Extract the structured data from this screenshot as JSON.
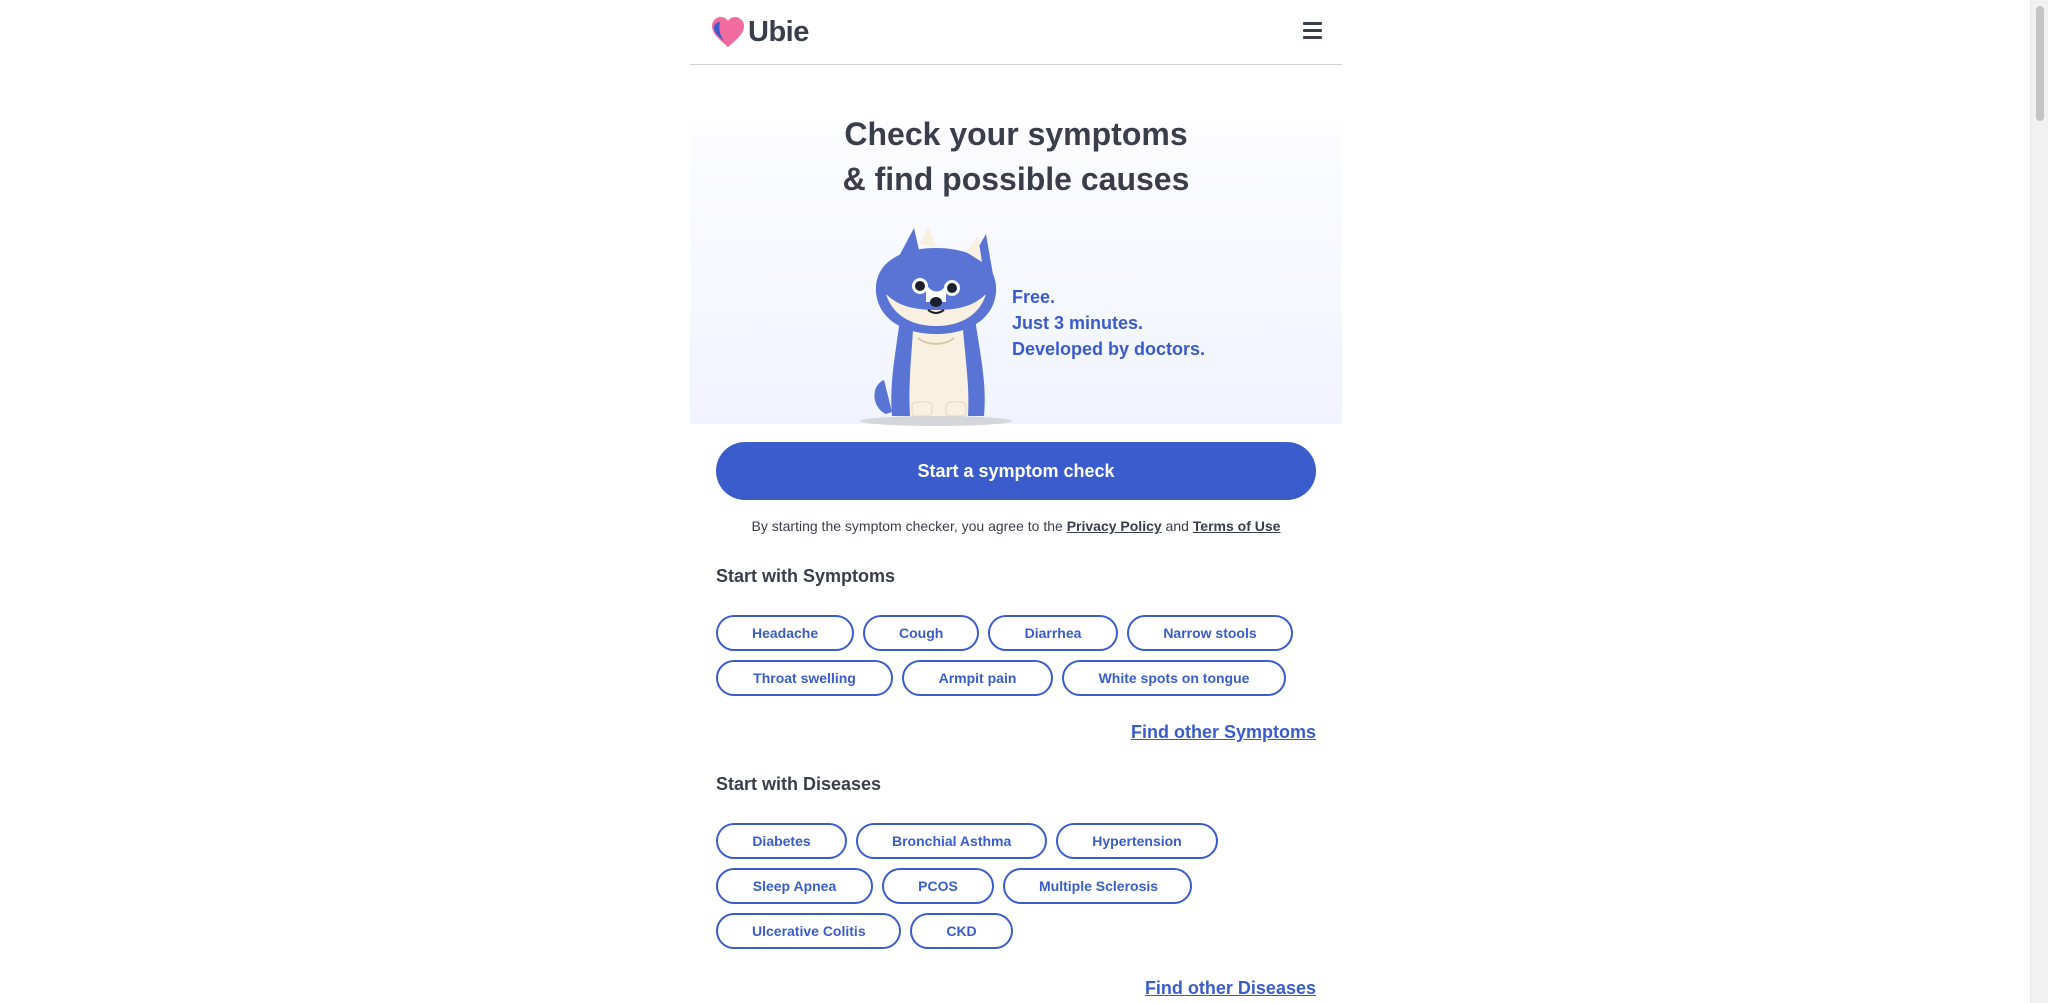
{
  "header": {
    "logo_text": "Ubie",
    "logo_icon": "heart-logo-icon",
    "menu_icon": "hamburger-menu-icon"
  },
  "hero": {
    "title_line1": "Check your symptoms",
    "title_line2": "& find possible causes",
    "taglines": [
      "Free.",
      "Just 3 minutes.",
      "Developed by doctors."
    ],
    "mascot": "dog-mascot-illustration"
  },
  "cta": {
    "label": "Start a symptom check"
  },
  "consent": {
    "prefix": "By starting the symptom checker, you agree to the",
    "privacy_label": "Privacy Policy",
    "and": "and",
    "terms_label": "Terms of Use"
  },
  "symptoms": {
    "title": "Start with Symptoms",
    "rows": [
      [
        "Headache",
        "Cough",
        "Diarrhea",
        "Narrow stools"
      ],
      [
        "Throat swelling",
        "Armpit pain",
        "White spots on tongue"
      ]
    ],
    "find_link": "Find other Symptoms"
  },
  "diseases": {
    "title": "Start with Diseases",
    "rows": [
      [
        "Diabetes",
        "Bronchial Asthma",
        "Hypertension"
      ],
      [
        "Sleep Apnea",
        "PCOS",
        "Multiple Sclerosis"
      ],
      [
        "Ulcerative Colitis",
        "CKD"
      ]
    ],
    "find_link": "Find other Diseases"
  },
  "colors": {
    "accent": "#3a5ccc",
    "text": "#3a3d4a",
    "logo_pink": "#f26b9f"
  }
}
